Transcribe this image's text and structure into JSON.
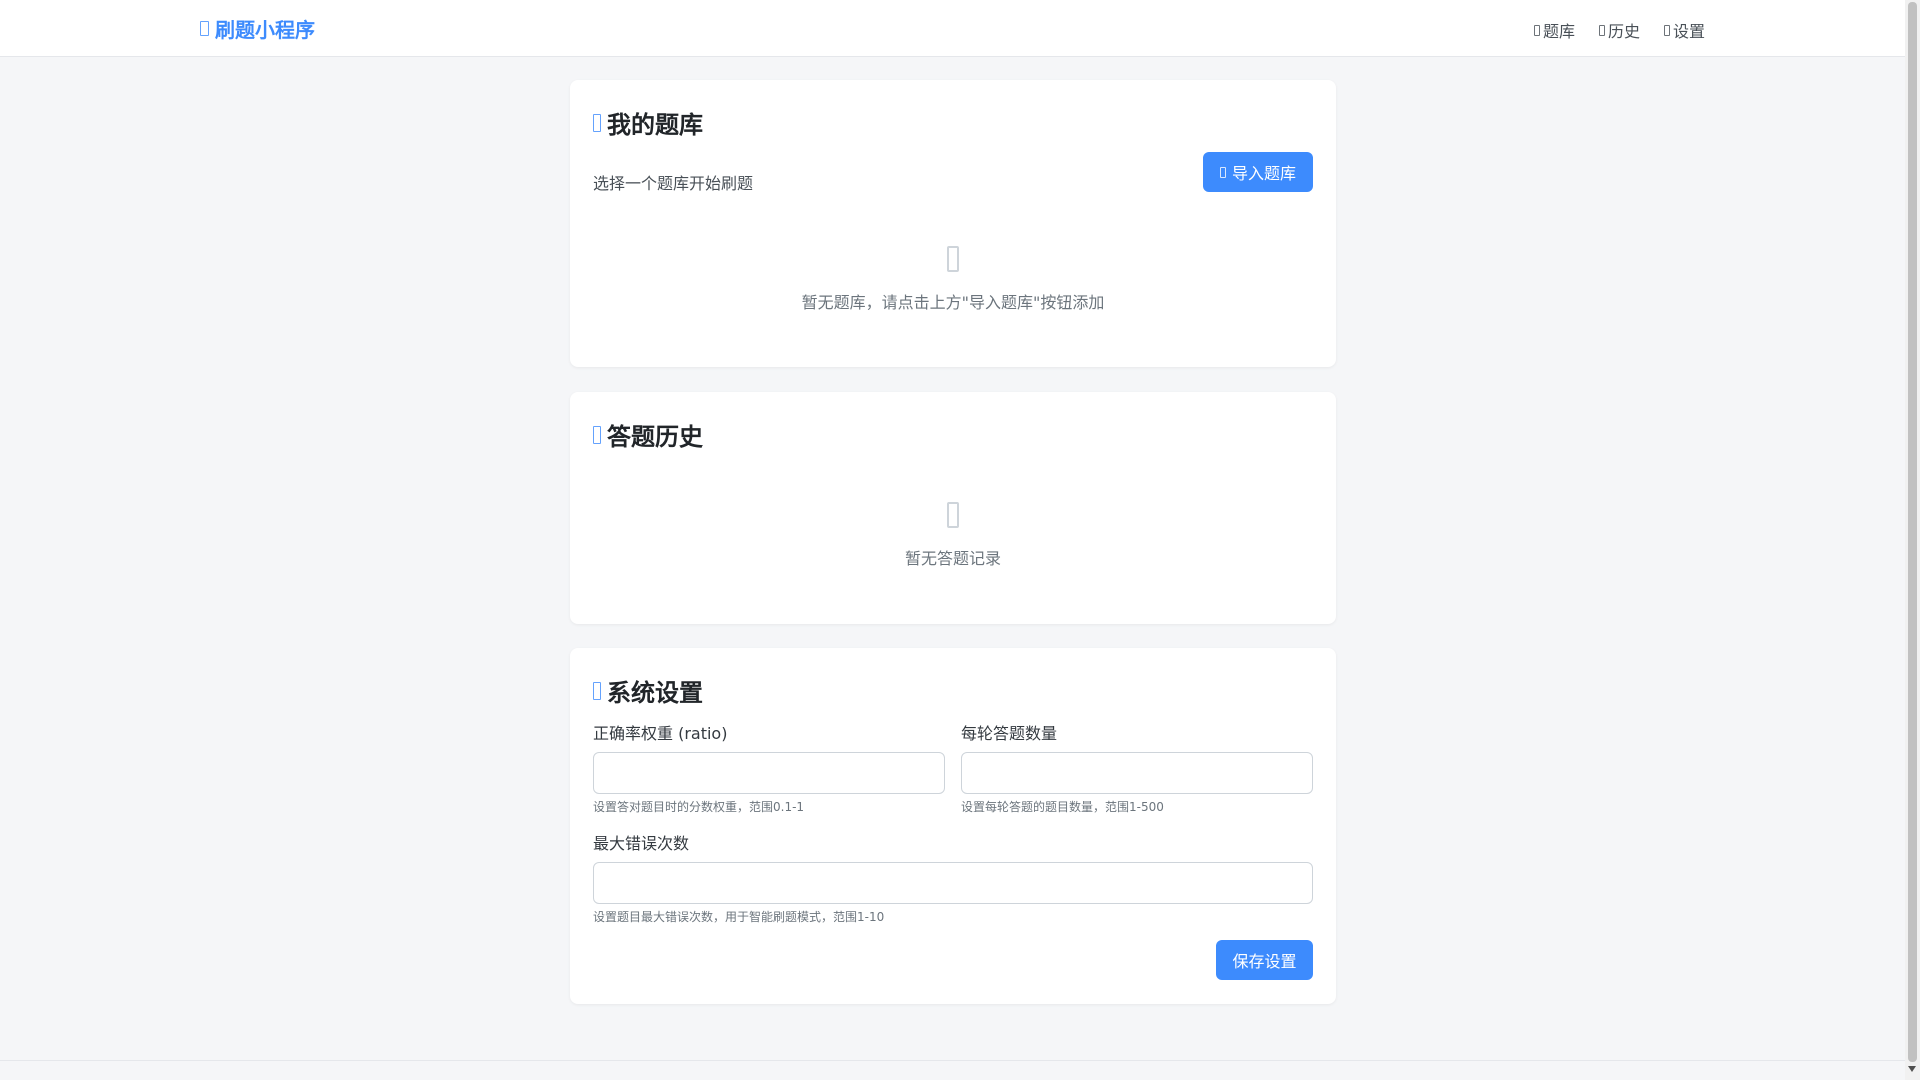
{
  "navbar": {
    "brand_icon": "book-icon",
    "brand": "刷题小程序",
    "links": [
      {
        "icon": "book-icon",
        "label": "题库"
      },
      {
        "icon": "history-icon",
        "label": "历史"
      },
      {
        "icon": "gear-icon",
        "label": "设置"
      }
    ]
  },
  "bank_card": {
    "title_icon": "book-icon",
    "title": "我的题库",
    "subtitle": "选择一个题库开始刷题",
    "import_icon": "upload-icon",
    "import_label": "导入题库",
    "empty_icon": "box-icon",
    "empty_text": "暂无题库，请点击上方\"导入题库\"按钮添加"
  },
  "history_card": {
    "title_icon": "history-icon",
    "title": "答题历史",
    "empty_icon": "clipboard-icon",
    "empty_text": "暂无答题记录"
  },
  "settings_card": {
    "title_icon": "gear-icon",
    "title": "系统设置",
    "ratio_label": "正确率权重 (ratio)",
    "ratio_value": "",
    "ratio_hint": "设置答对题目时的分数权重，范围0.1-1",
    "count_label": "每轮答题数量",
    "count_value": "",
    "count_hint": "设置每轮答题的题目数量，范围1-500",
    "maxerr_label": "最大错误次数",
    "maxerr_value": "",
    "maxerr_hint": "设置题目最大错误次数，用于智能刷题模式，范围1-10",
    "save_label": "保存设置"
  },
  "colors": {
    "primary": "#3d8bfd",
    "background": "#f5f6f8",
    "card": "#ffffff",
    "muted_text": "#6c757d"
  }
}
